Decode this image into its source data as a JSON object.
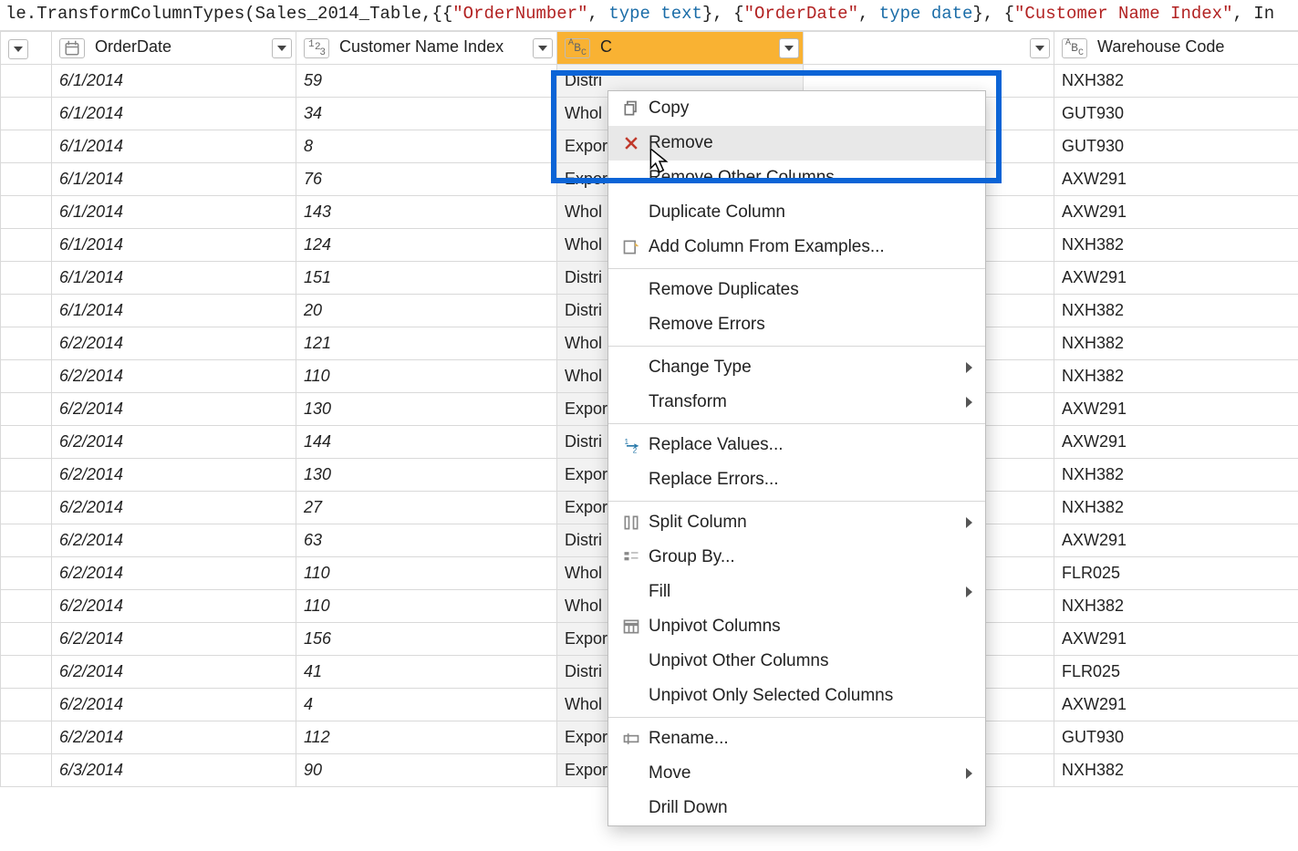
{
  "formula": {
    "prefix": "le.TransformColumnTypes(Sales_2014_Table,{{",
    "s1": "\"OrderNumber\"",
    "kw": "type",
    "kw_text": "text",
    "kw_date": "date",
    "s2": "\"OrderDate\"",
    "s3": "\"Customer Name Index\"",
    "tail": ", In"
  },
  "columns": {
    "orderDate": "OrderDate",
    "custIndex": "Customer Name Index",
    "channelPrefix": "C",
    "warehouse": "Warehouse Code"
  },
  "rows": [
    {
      "date": "6/1/2014",
      "idx": 59,
      "chan": "Distri",
      "wh": "NXH382"
    },
    {
      "date": "6/1/2014",
      "idx": 34,
      "chan": "Whol",
      "wh": "GUT930"
    },
    {
      "date": "6/1/2014",
      "idx": 8,
      "chan": "Expor",
      "wh": "GUT930"
    },
    {
      "date": "6/1/2014",
      "idx": 76,
      "chan": "Expor",
      "wh": "AXW291"
    },
    {
      "date": "6/1/2014",
      "idx": 143,
      "chan": "Whol",
      "wh": "AXW291"
    },
    {
      "date": "6/1/2014",
      "idx": 124,
      "chan": "Whol",
      "wh": "NXH382"
    },
    {
      "date": "6/1/2014",
      "idx": 151,
      "chan": "Distri",
      "wh": "AXW291"
    },
    {
      "date": "6/1/2014",
      "idx": 20,
      "chan": "Distri",
      "wh": "NXH382"
    },
    {
      "date": "6/2/2014",
      "idx": 121,
      "chan": "Whol",
      "wh": "NXH382"
    },
    {
      "date": "6/2/2014",
      "idx": 110,
      "chan": "Whol",
      "wh": "NXH382"
    },
    {
      "date": "6/2/2014",
      "idx": 130,
      "chan": "Expor",
      "wh": "AXW291"
    },
    {
      "date": "6/2/2014",
      "idx": 144,
      "chan": "Distri",
      "wh": "AXW291"
    },
    {
      "date": "6/2/2014",
      "idx": 130,
      "chan": "Expor",
      "wh": "NXH382"
    },
    {
      "date": "6/2/2014",
      "idx": 27,
      "chan": "Expor",
      "wh": "NXH382"
    },
    {
      "date": "6/2/2014",
      "idx": 63,
      "chan": "Distri",
      "wh": "AXW291"
    },
    {
      "date": "6/2/2014",
      "idx": 110,
      "chan": "Whol",
      "wh": "FLR025"
    },
    {
      "date": "6/2/2014",
      "idx": 110,
      "chan": "Whol",
      "wh": "NXH382"
    },
    {
      "date": "6/2/2014",
      "idx": 156,
      "chan": "Expor",
      "wh": "AXW291"
    },
    {
      "date": "6/2/2014",
      "idx": 41,
      "chan": "Distri",
      "wh": "FLR025"
    },
    {
      "date": "6/2/2014",
      "idx": 4,
      "chan": "Whol",
      "wh": "AXW291"
    },
    {
      "date": "6/2/2014",
      "idx": 112,
      "chan": "Expor",
      "wh": "GUT930"
    },
    {
      "date": "6/3/2014",
      "idx": 90,
      "chan": "Expor",
      "wh": "NXH382"
    }
  ],
  "menu": {
    "copy": "Copy",
    "remove": "Remove",
    "removeOther": "Remove Other Columns",
    "duplicate": "Duplicate Column",
    "addFromEx": "Add Column From Examples...",
    "removeDup": "Remove Duplicates",
    "removeErr": "Remove Errors",
    "changeType": "Change Type",
    "transform": "Transform",
    "replaceVals": "Replace Values...",
    "replaceErrs": "Replace Errors...",
    "splitColumn": "Split Column",
    "groupBy": "Group By...",
    "fill": "Fill",
    "unpivotCols": "Unpivot Columns",
    "unpivotOther": "Unpivot Other Columns",
    "unpivotOnly": "Unpivot Only Selected Columns",
    "rename": "Rename...",
    "move": "Move",
    "drillDown": "Drill Down"
  }
}
